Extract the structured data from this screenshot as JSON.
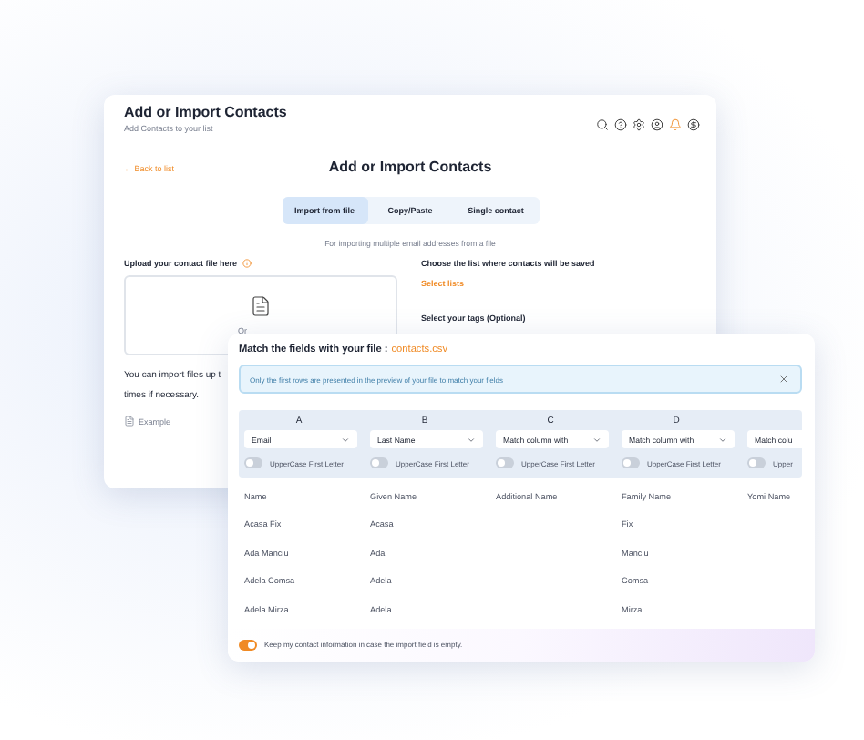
{
  "contacts_page": {
    "title": "Add or Import Contacts",
    "subtitle": "Add Contacts to your list",
    "back_link": "← Back to list",
    "heading": "Add or Import Contacts",
    "tabs": [
      {
        "label": "Import from file",
        "selected": true
      },
      {
        "label": "Copy/Paste",
        "selected": false
      },
      {
        "label": "Single contact",
        "selected": false
      }
    ],
    "tab_hint": "For importing multiple email addresses from a file",
    "upload": {
      "label": "Upload your contact file here",
      "dropzone_text": "Or",
      "note_lines": [
        "You can import files up t",
        "times if necessary."
      ],
      "example_link": "Example"
    },
    "list_select": {
      "label": "Choose the list where contacts will be saved",
      "link": "Select lists"
    },
    "tags": {
      "label": "Select your tags (Optional)"
    }
  },
  "match_dialog": {
    "title": "Match the fields with your file :",
    "file_name": "contacts.csv",
    "notice": "Only the first rows are presented in the preview of your file to match your fields",
    "mappings": [
      {
        "letter": "A",
        "field": "Email",
        "toggle_label": "UpperCase First Letter",
        "on": false
      },
      {
        "letter": "B",
        "field": "Last Name",
        "toggle_label": "UpperCase First Letter",
        "on": false
      },
      {
        "letter": "C",
        "field": "Match column with",
        "toggle_label": "UpperCase First Letter",
        "on": false
      },
      {
        "letter": "D",
        "field": "Match column with",
        "toggle_label": "UpperCase First Letter",
        "on": false
      },
      {
        "field": "Match colu",
        "toggle_label": "Upper",
        "on": false
      }
    ],
    "columns": [
      "Name",
      "Given Name",
      "Additional Name",
      "Family Name",
      "Yomi Name"
    ],
    "rows": [
      [
        "Acasa Fix",
        "Acasa",
        null,
        "Fix",
        null
      ],
      [
        "Ada Manciu",
        "Ada",
        null,
        "Manciu",
        null
      ],
      [
        "Adela Comsa",
        "Adela",
        null,
        "Comsa",
        null
      ],
      [
        "Adela Mirza",
        "Adela",
        null,
        "Mirza",
        null
      ]
    ],
    "keep_info": {
      "label": "Keep my contact information in case the import field is empty.",
      "on": true
    }
  }
}
